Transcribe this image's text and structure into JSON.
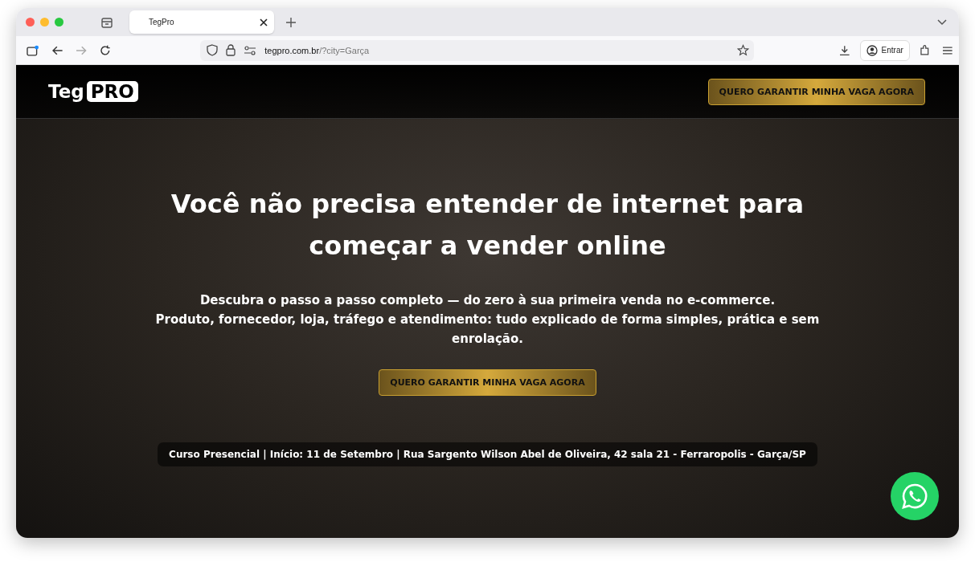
{
  "browser": {
    "tabs": [
      {
        "title": "TegPro",
        "selected": true
      }
    ],
    "url_host": "tegpro.com.br",
    "url_path": "/?city=Garça",
    "sign_in": "Entrar"
  },
  "header": {
    "logo_left": "Teg",
    "logo_right": "PRO",
    "cta": "QUERO GARANTIR MINHA VAGA AGORA"
  },
  "hero": {
    "headline": "Você não precisa entender de internet para começar a vender online",
    "lines": [
      "Descubra o passo a passo completo — do zero à sua primeira venda no e-commerce.",
      "Produto, fornecedor, loja, tráfego e atendimento: tudo explicado de forma simples, prática e sem enrolação."
    ],
    "cta": "QUERO GARANTIR MINHA VAGA AGORA",
    "info": "Curso Presencial | Início: 11 de Setembro | Rua Sargento Wilson Abel de Oliveira, 42 sala 21 - Ferraropolis - Garça/SP"
  }
}
